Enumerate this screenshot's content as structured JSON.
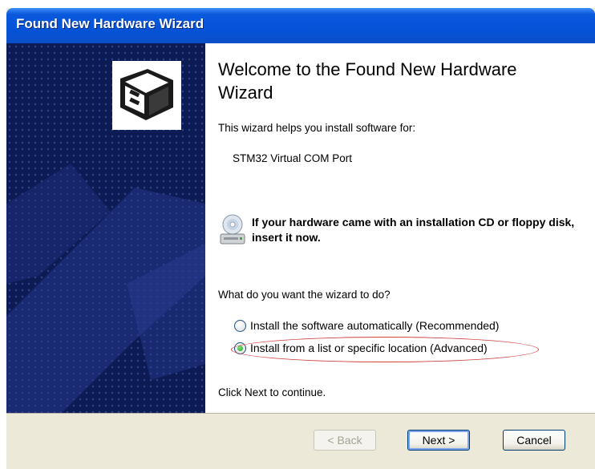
{
  "window": {
    "title": "Found New Hardware Wizard"
  },
  "icons": {
    "hardware": "hardware-card-icon",
    "cd": "cd-drive-icon"
  },
  "main": {
    "heading": "Welcome to the Found New Hardware Wizard",
    "intro": "This wizard helps you install software for:",
    "device_name": "STM32 Virtual COM Port",
    "cd_prompt": "If your hardware came with an installation CD or floppy disk, insert it now.",
    "question": "What do you want the wizard to do?",
    "options": [
      {
        "label": "Install the software automatically (Recommended)",
        "selected": false
      },
      {
        "label": "Install from a list or specific location (Advanced)",
        "selected": true
      }
    ],
    "continue_text": "Click Next to continue."
  },
  "buttons": {
    "back": "< Back",
    "next": "Next >",
    "cancel": "Cancel"
  },
  "colors": {
    "titlebar": "#0553d8",
    "panel": "#0c1b54",
    "highlight": "#d04040"
  }
}
